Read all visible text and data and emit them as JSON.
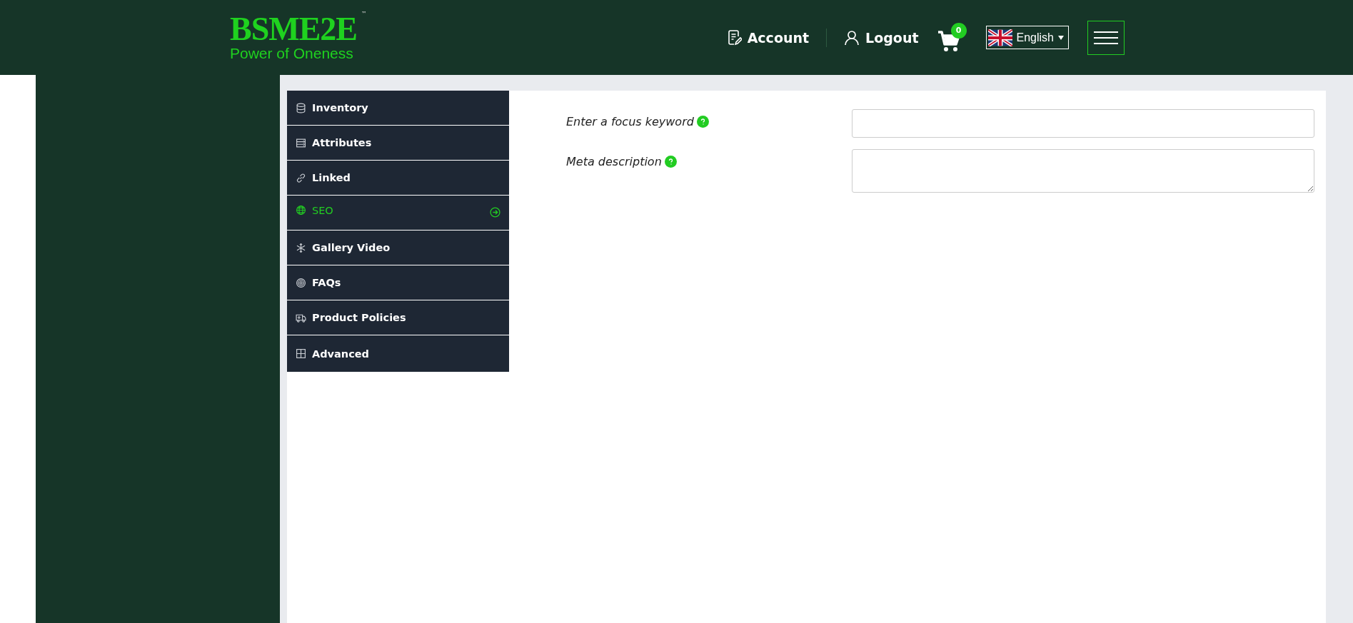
{
  "header": {
    "logo": {
      "name": "BSME2E",
      "trademark": "™",
      "tagline": "Power of Oneness"
    },
    "nav": [
      {
        "label": "Account"
      },
      {
        "label": "Logout"
      }
    ],
    "cart": {
      "count": "0"
    },
    "language": {
      "label": "English"
    }
  },
  "tabs": [
    {
      "label": "Inventory",
      "selected": false
    },
    {
      "label": "Attributes",
      "selected": false
    },
    {
      "label": "Linked",
      "selected": false
    },
    {
      "label": "SEO",
      "selected": true
    },
    {
      "label": "Gallery Video",
      "selected": false
    },
    {
      "label": "FAQs",
      "selected": false
    },
    {
      "label": "Product Policies",
      "selected": false
    },
    {
      "label": "Advanced",
      "selected": false
    }
  ],
  "form": {
    "fields": [
      {
        "label": "Enter a focus keyword",
        "kind": "input"
      },
      {
        "label": "Meta description",
        "kind": "textarea"
      }
    ]
  }
}
